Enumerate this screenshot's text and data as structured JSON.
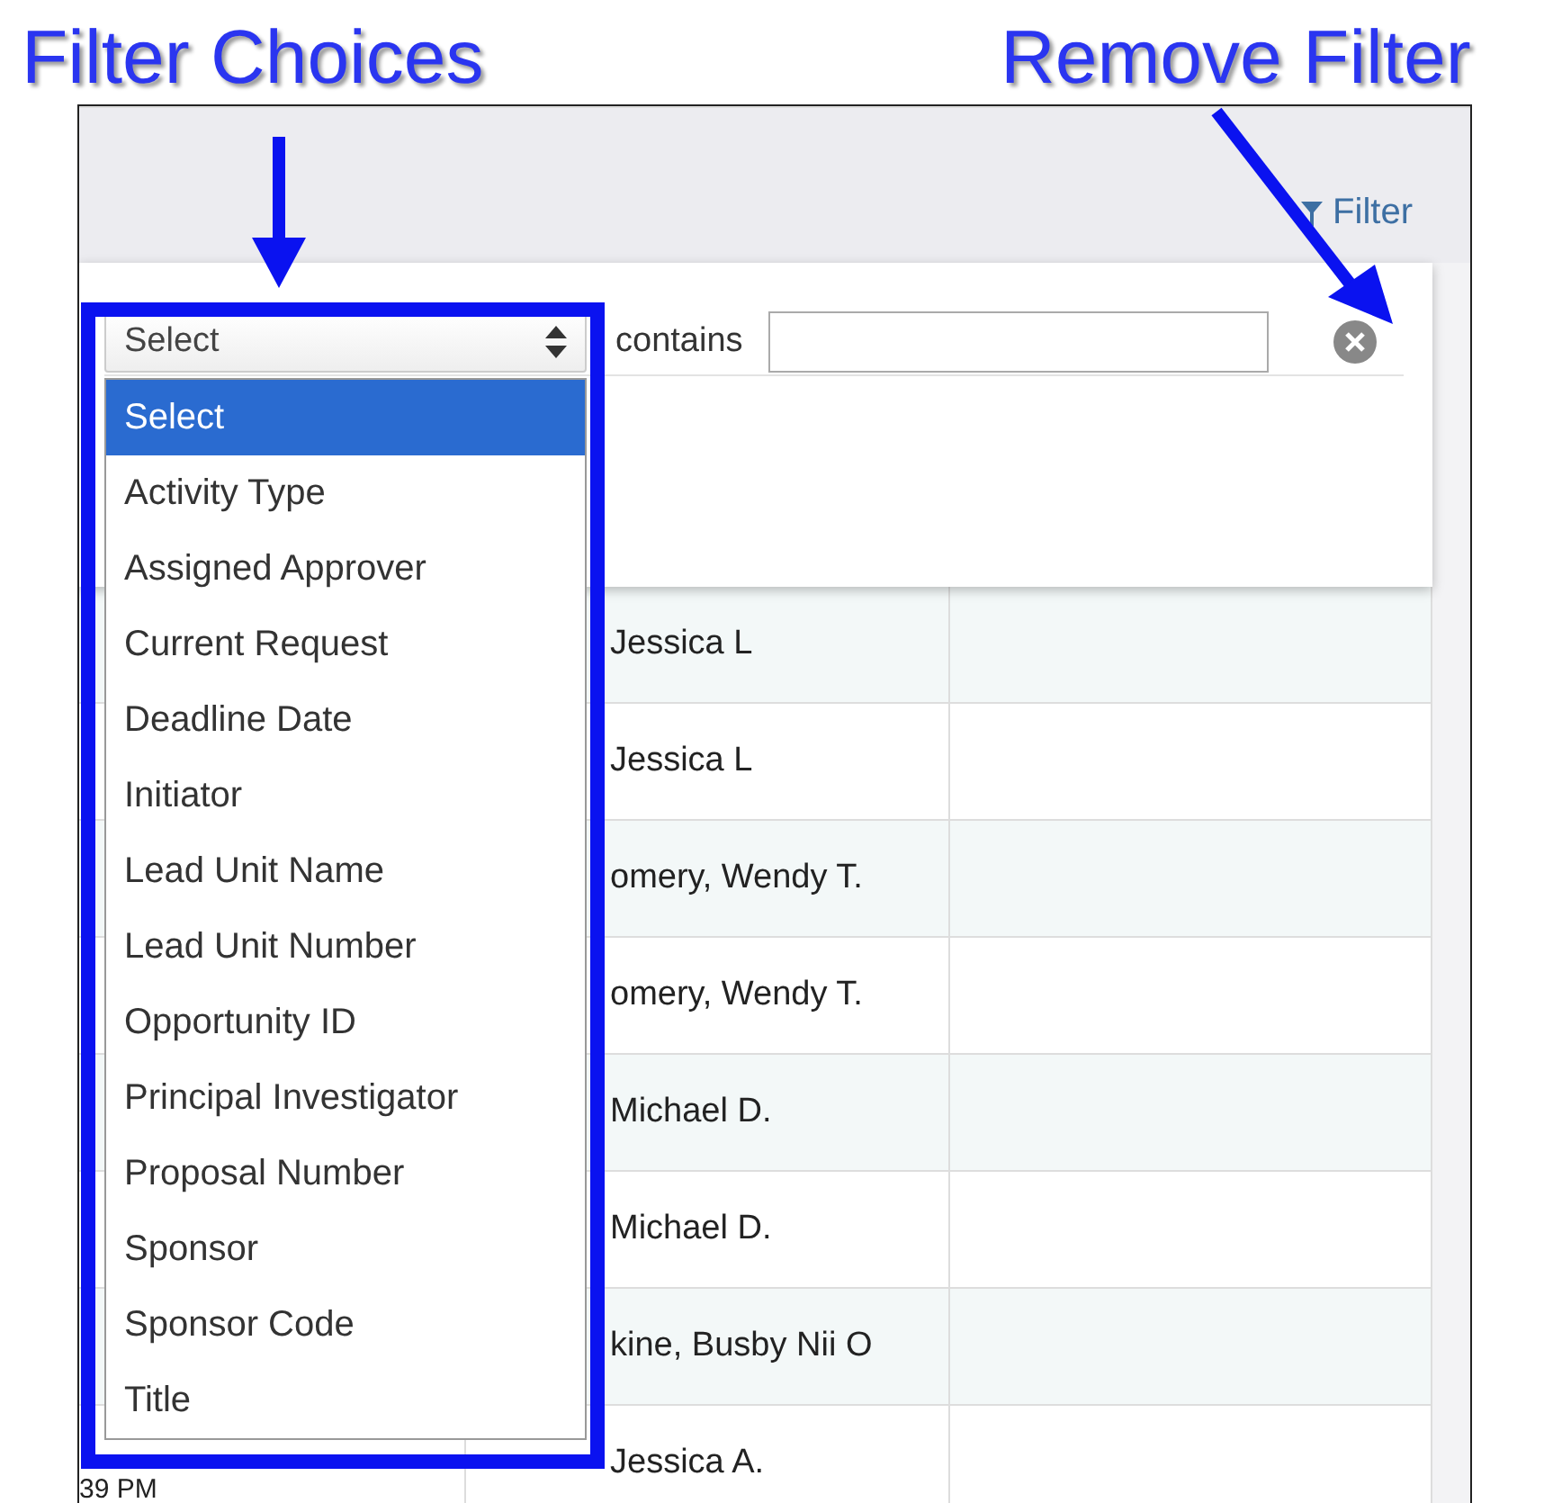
{
  "annotations": [
    {
      "label": "Filter Choices"
    },
    {
      "label": "Remove Filter"
    }
  ],
  "header": {
    "link": "Filter"
  },
  "filter": {
    "field": "Select",
    "operator": "contains",
    "options": [
      {
        "label": "Select",
        "selected": true
      },
      {
        "label": "Activity Type",
        "selected": false
      },
      {
        "label": "Assigned Approver",
        "selected": false
      },
      {
        "label": "Current Request",
        "selected": false
      },
      {
        "label": "Deadline Date",
        "selected": false
      },
      {
        "label": "Initiator",
        "selected": false
      },
      {
        "label": "Lead Unit Name",
        "selected": false
      },
      {
        "label": "Lead Unit Number",
        "selected": false
      },
      {
        "label": "Opportunity ID",
        "selected": false
      },
      {
        "label": "Principal Investigator",
        "selected": false
      },
      {
        "label": "Proposal Number",
        "selected": false
      },
      {
        "label": "Sponsor",
        "selected": false
      },
      {
        "label": "Sponsor Code",
        "selected": false
      },
      {
        "label": "Title",
        "selected": false
      }
    ]
  },
  "table": {
    "rows": [
      {
        "name": "Jessica L"
      },
      {
        "name": "Jessica L"
      },
      {
        "name": "omery, Wendy T."
      },
      {
        "name": "omery, Wendy T."
      },
      {
        "name": "Michael D."
      },
      {
        "name": "Michael D."
      },
      {
        "name": "kine, Busby Nii O"
      },
      {
        "time": "39 PM",
        "name": "Jessica A."
      }
    ]
  }
}
